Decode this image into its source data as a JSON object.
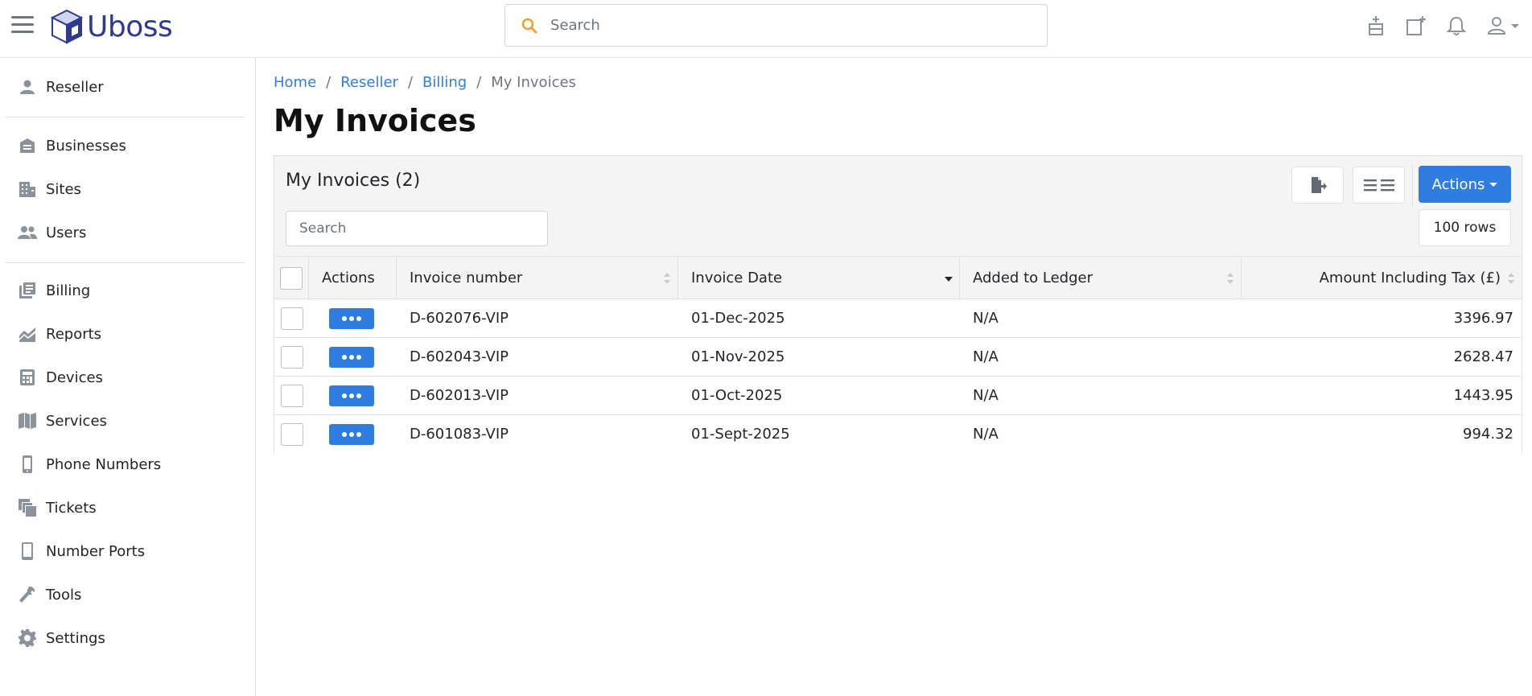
{
  "app": {
    "brand": "Uboss"
  },
  "search": {
    "placeholder": "Search"
  },
  "sidebar": {
    "items": [
      {
        "label": "Reseller",
        "icon": "person-icon"
      },
      {
        "label": "Businesses",
        "icon": "building-icon"
      },
      {
        "label": "Sites",
        "icon": "office-block-icon"
      },
      {
        "label": "Users",
        "icon": "users-icon"
      },
      {
        "label": "Billing",
        "icon": "billing-icon"
      },
      {
        "label": "Reports",
        "icon": "chart-area-icon"
      },
      {
        "label": "Devices",
        "icon": "calculator-icon"
      },
      {
        "label": "Services",
        "icon": "map-book-icon"
      },
      {
        "label": "Phone Numbers",
        "icon": "mobile-phone-icon"
      },
      {
        "label": "Tickets",
        "icon": "copies-icon"
      },
      {
        "label": "Number Ports",
        "icon": "tablet-icon"
      },
      {
        "label": "Tools",
        "icon": "wrench-icon"
      },
      {
        "label": "Settings",
        "icon": "gear-icon"
      }
    ]
  },
  "breadcrumb": {
    "home": "Home",
    "reseller": "Reseller",
    "billing": "Billing",
    "current": "My Invoices",
    "separator": "/"
  },
  "page": {
    "title": "My Invoices"
  },
  "card": {
    "title": "My Invoices (2)",
    "search_placeholder": "Search",
    "actions_label": "Actions",
    "rows_label": "100 rows"
  },
  "table": {
    "columns": {
      "actions": "Actions",
      "invoice_number": "Invoice number",
      "invoice_date": "Invoice Date",
      "added_to_ledger": "Added to Ledger",
      "amount": "Amount Including Tax (£)"
    },
    "rows": [
      {
        "invoice_number": "D-602076-VIP",
        "invoice_date": "01-Dec-2025",
        "added_to_ledger": "N/A",
        "amount": "3396.97"
      },
      {
        "invoice_number": "D-602043-VIP",
        "invoice_date": "01-Nov-2025",
        "added_to_ledger": "N/A",
        "amount": "2628.47"
      },
      {
        "invoice_number": "D-602013-VIP",
        "invoice_date": "01-Oct-2025",
        "added_to_ledger": "N/A",
        "amount": "1443.95"
      },
      {
        "invoice_number": "D-601083-VIP",
        "invoice_date": "01-Sept-2025",
        "added_to_ledger": "N/A",
        "amount": "994.32"
      }
    ]
  },
  "colors": {
    "accent": "#2f7de1",
    "brand": "#2f3a8f",
    "search_icon": "#f0a030"
  }
}
